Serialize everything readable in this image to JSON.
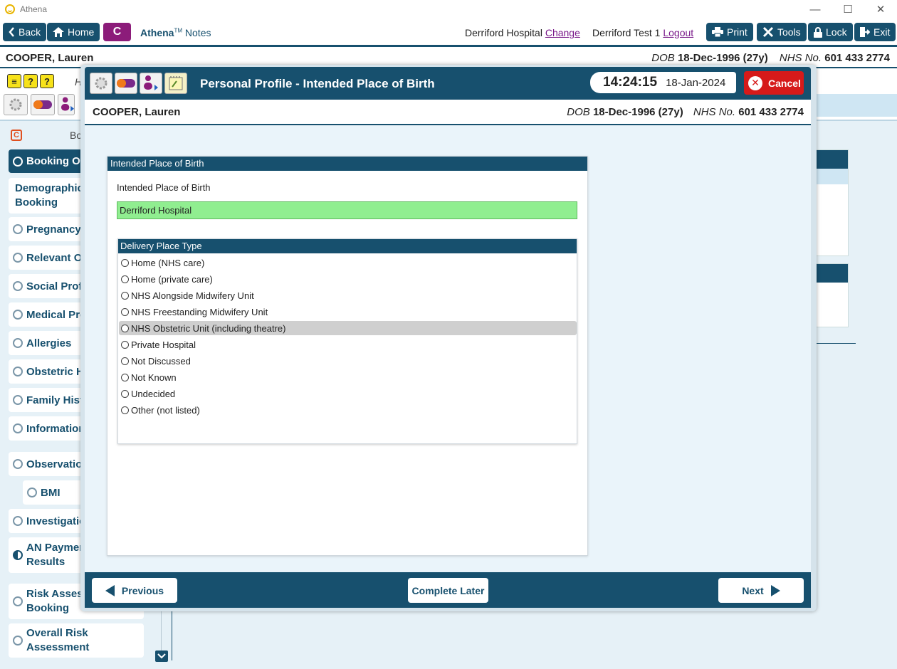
{
  "window": {
    "title": "Athena",
    "minimize": "—",
    "maximize": "☐",
    "close": "✕"
  },
  "toolbar": {
    "back": "Back",
    "home": "Home",
    "c_button": "C",
    "brand": "Athena",
    "brand_tm": "TM",
    "brand_suffix": "Notes",
    "hospital": "Derriford Hospital",
    "change": "Change",
    "user": "Derriford Test 1",
    "logout": "Logout",
    "print": "Print",
    "tools": "Tools",
    "lock": "Lock",
    "exit": "Exit"
  },
  "patient": {
    "name": "COOPER, Lauren",
    "dob_label": "DOB",
    "dob": "18-Dec-1996 (27y)",
    "nhs_label": "NHS No.",
    "nhs": "601 433 2774"
  },
  "background": {
    "h_label": "H",
    "bo_label": "Bo",
    "c_label": "C",
    "nav": [
      {
        "label": "Booking Ov",
        "active": true
      },
      {
        "label": "Demographics",
        "label2": "Booking",
        "noradio": true
      },
      {
        "label": "Pregnancy I"
      },
      {
        "label": "Relevant Ot"
      },
      {
        "label": "Social Profil"
      },
      {
        "label": "Medical Pro"
      },
      {
        "label": "Allergies"
      },
      {
        "label": "Obstetric H"
      },
      {
        "label": "Family Histo"
      },
      {
        "label": "Information"
      },
      {
        "label": "Observation"
      },
      {
        "label": "BMI"
      },
      {
        "label": "Investigatio"
      },
      {
        "label": "AN Paymen",
        "label2": "Results",
        "half": true
      },
      {
        "label": "Risk Assess",
        "label2": "Booking"
      },
      {
        "label": "Overall Risk",
        "label2": "Assessment"
      }
    ]
  },
  "modal": {
    "title": "Personal Profile - Intended Place of Birth",
    "time": "14:24:15",
    "date": "18-Jan-2024",
    "cancel": "Cancel",
    "section_title": "Intended Place of Birth",
    "field_label": "Intended Place of Birth",
    "field_value": "Derriford Hospital",
    "delivery_title": "Delivery Place Type",
    "options": [
      "Home (NHS care)",
      "Home (private care)",
      "NHS Alongside Midwifery Unit",
      "NHS Freestanding Midwifery Unit",
      "NHS Obstetric Unit (including theatre)",
      "Private Hospital",
      "Not Discussed",
      "Not Known",
      "Undecided",
      "Other (not listed)"
    ],
    "highlighted_option": "NHS Obstetric Unit (including theatre)",
    "previous": "Previous",
    "complete_later": "Complete Later",
    "next": "Next"
  },
  "colors": {
    "primary": "#17506e",
    "accent_purple": "#8c1c7a",
    "cancel_red": "#d61a1a",
    "field_green": "#90ee90"
  }
}
